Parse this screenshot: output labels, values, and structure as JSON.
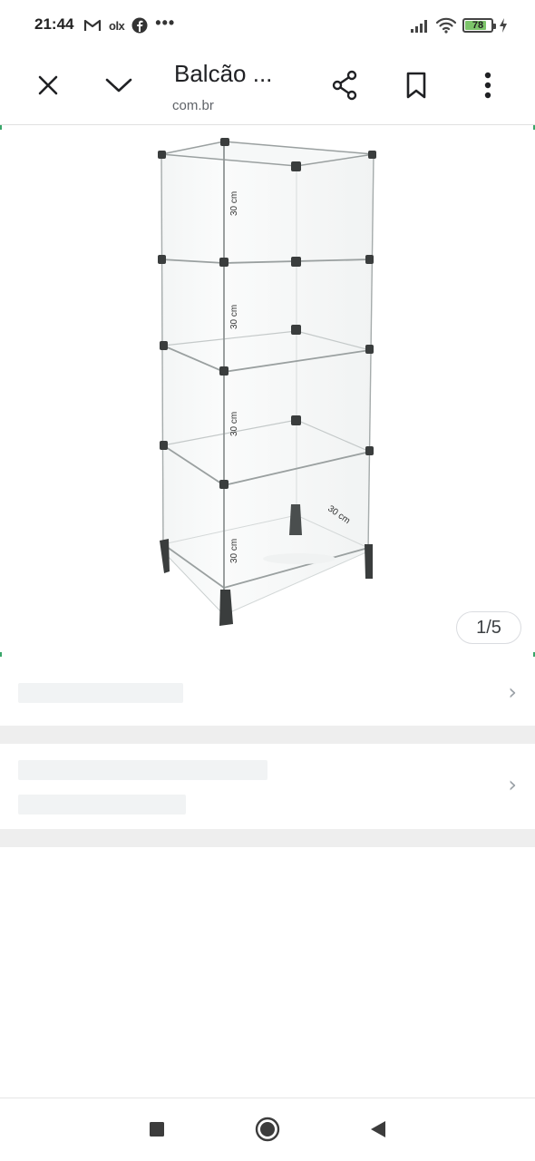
{
  "status_bar": {
    "time": "21:44",
    "notif_icons": [
      "gmail-icon",
      "olx-icon",
      "facebook-icon",
      "more-dots-icon"
    ],
    "olx_text": "olx",
    "dots_text": "•••",
    "battery_level": "78",
    "battery_percent": 78,
    "sys_icons": [
      "signal-icon",
      "wifi-icon",
      "battery-icon",
      "charging-bolt-icon"
    ]
  },
  "toolbar": {
    "title": "Balcão ...",
    "url": "com.br",
    "buttons": [
      "close-icon",
      "chevron-down-icon",
      "share-icon",
      "bookmark-icon",
      "overflow-menu-icon"
    ]
  },
  "image": {
    "page_indicator": "1/5",
    "dimension_labels": [
      "30 cm",
      "30 cm",
      "30 cm",
      "30 cm",
      "30 cm"
    ]
  },
  "colors": {
    "accent_green": "#3aa66a",
    "skeleton": "#f1f3f4",
    "divider": "#eeeeee",
    "battery_fill": "#7cc46a"
  },
  "navbar": {
    "buttons": [
      "recents-square-icon",
      "home-circle-icon",
      "back-triangle-icon"
    ]
  }
}
